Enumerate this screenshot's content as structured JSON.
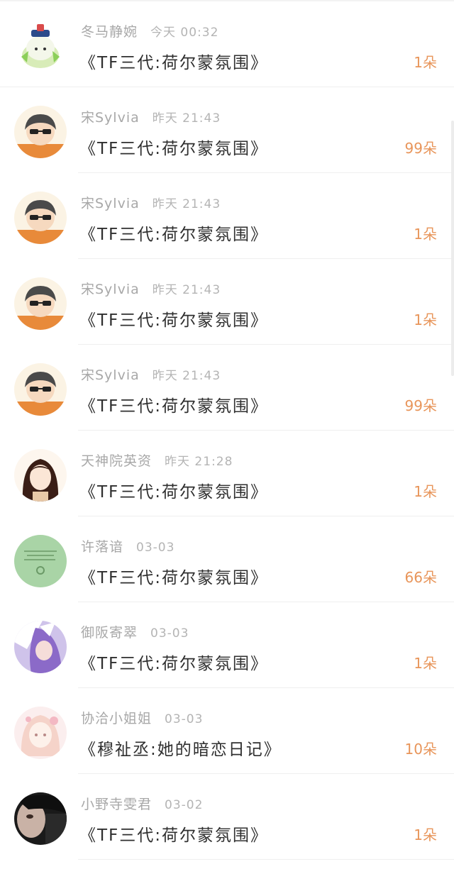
{
  "items": [
    {
      "name": "冬马静婉",
      "time": "今天 00:32",
      "title": "《TF三代:荷尔蒙氛围》",
      "count": "1朵",
      "avatar": "cartoon-avatar"
    },
    {
      "name": "宋Sylvia",
      "time": "昨天 21:43",
      "title": "《TF三代:荷尔蒙氛围》",
      "count": "99朵",
      "avatar": "cartoon-avatar"
    },
    {
      "name": "宋Sylvia",
      "time": "昨天 21:43",
      "title": "《TF三代:荷尔蒙氛围》",
      "count": "1朵",
      "avatar": "cartoon-avatar"
    },
    {
      "name": "宋Sylvia",
      "time": "昨天 21:43",
      "title": "《TF三代:荷尔蒙氛围》",
      "count": "1朵",
      "avatar": "cartoon-avatar"
    },
    {
      "name": "宋Sylvia",
      "time": "昨天 21:43",
      "title": "《TF三代:荷尔蒙氛围》",
      "count": "99朵",
      "avatar": "cartoon-avatar"
    },
    {
      "name": "天神院英资",
      "time": "昨天 21:28",
      "title": "《TF三代:荷尔蒙氛围》",
      "count": "1朵",
      "avatar": "anime-girl-avatar"
    },
    {
      "name": "许落谙",
      "time": "03-03",
      "title": "《TF三代:荷尔蒙氛围》",
      "count": "66朵",
      "avatar": "green-text-avatar"
    },
    {
      "name": "御阪寄翠",
      "time": "03-03",
      "title": "《TF三代:荷尔蒙氛围》",
      "count": "1朵",
      "avatar": "anime-girl-avatar"
    },
    {
      "name": "协洽小姐姐",
      "time": "03-03",
      "title": "《穆祉丞:她的暗恋日记》",
      "count": "10朵",
      "avatar": "anime-girl-avatar"
    },
    {
      "name": "小野寺雯君",
      "time": "03-02",
      "title": "《TF三代:荷尔蒙氛围》",
      "count": "1朵",
      "avatar": "photo-avatar"
    }
  ],
  "colors": {
    "count_accent": "#e8955a",
    "name_gray": "#a8a8a8",
    "title_dark": "#2f2f2f"
  }
}
